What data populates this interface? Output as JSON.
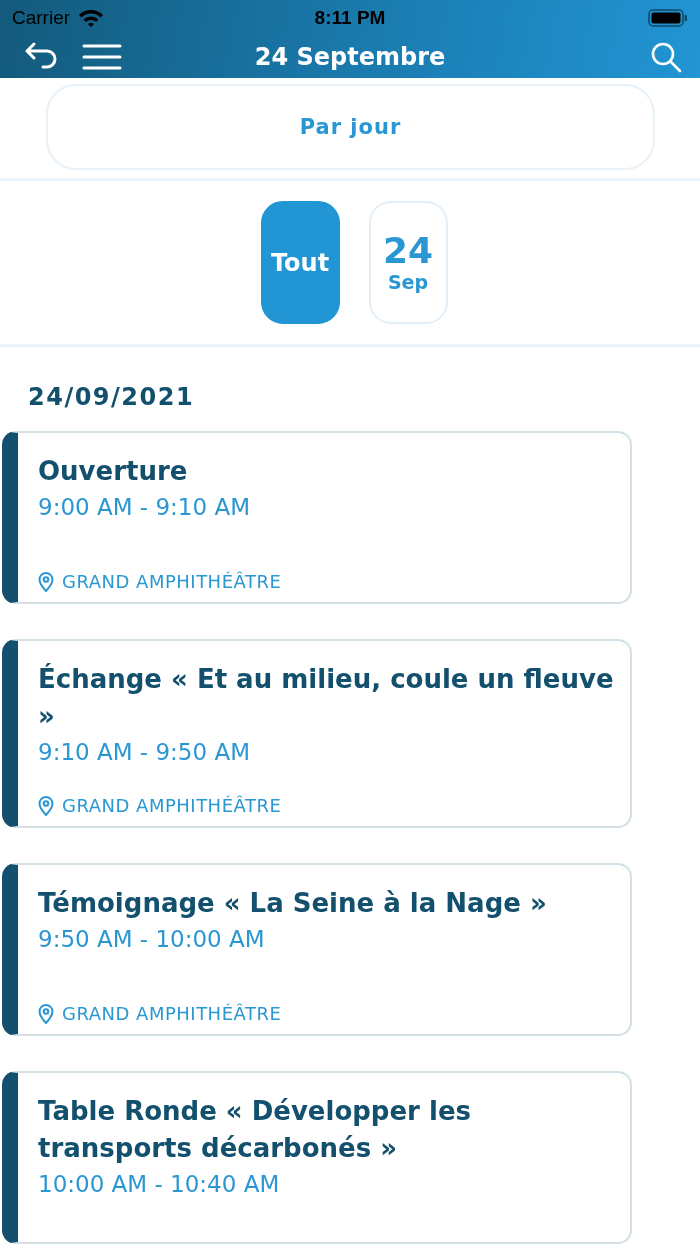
{
  "status_bar": {
    "carrier": "Carrier",
    "time": "8:11 PM"
  },
  "nav": {
    "title": "24 Septembre"
  },
  "view_toggle": {
    "label": "Par jour"
  },
  "days": [
    {
      "kind": "all",
      "label": "Tout",
      "selected": true
    },
    {
      "kind": "date",
      "day": "24",
      "month": "Sep",
      "selected": false
    }
  ],
  "date_heading": "24/09/2021",
  "events": [
    {
      "title": "Ouverture",
      "time": "9:00 AM - 9:10 AM",
      "location": "GRAND AMPHITHÉÂTRE"
    },
    {
      "title": "Échange « Et au milieu, coule un fleuve »",
      "time": "9:10 AM - 9:50 AM",
      "location": "GRAND AMPHITHÉÂTRE"
    },
    {
      "title": "Témoignage « La Seine à la Nage »",
      "time": "9:50 AM - 10:00 AM",
      "location": "GRAND AMPHITHÉÂTRE"
    },
    {
      "title": "Table Ronde « Développer les transports décarbonés »",
      "time": "10:00 AM - 10:40 AM"
    }
  ]
}
